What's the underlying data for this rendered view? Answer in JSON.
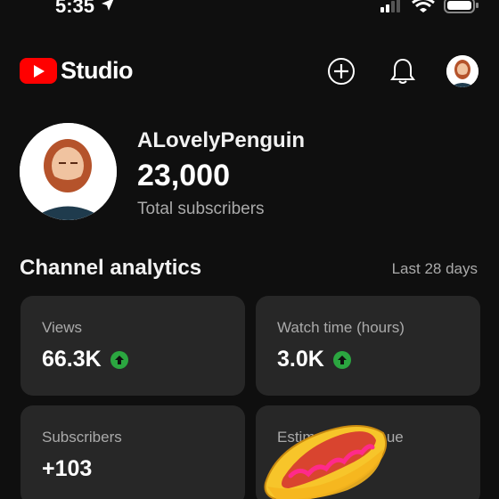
{
  "status_bar": {
    "time": "5:35",
    "icons": [
      "location-arrow-icon",
      "cellular-signal-icon",
      "wifi-icon",
      "battery-icon"
    ]
  },
  "header": {
    "logo_text": "Studio",
    "brand_color": "#ff0000",
    "actions": [
      "create-icon",
      "notifications-icon",
      "account-avatar"
    ]
  },
  "channel": {
    "name": "ALovelyPenguin",
    "subscriber_count": "23,000",
    "subscriber_label": "Total subscribers"
  },
  "analytics": {
    "title": "Channel analytics",
    "range": "Last 28 days",
    "cards": [
      {
        "label": "Views",
        "value": "66.3K",
        "trend": "up"
      },
      {
        "label": "Watch time (hours)",
        "value": "3.0K",
        "trend": "up"
      },
      {
        "label": "Subscribers",
        "value": "+103",
        "trend": "none"
      },
      {
        "label": "Estimated revenue",
        "value": "",
        "trend": "none"
      }
    ],
    "trend_up_color": "#2ba640"
  },
  "overlay": {
    "sticker": "hot-dog-sticker"
  }
}
